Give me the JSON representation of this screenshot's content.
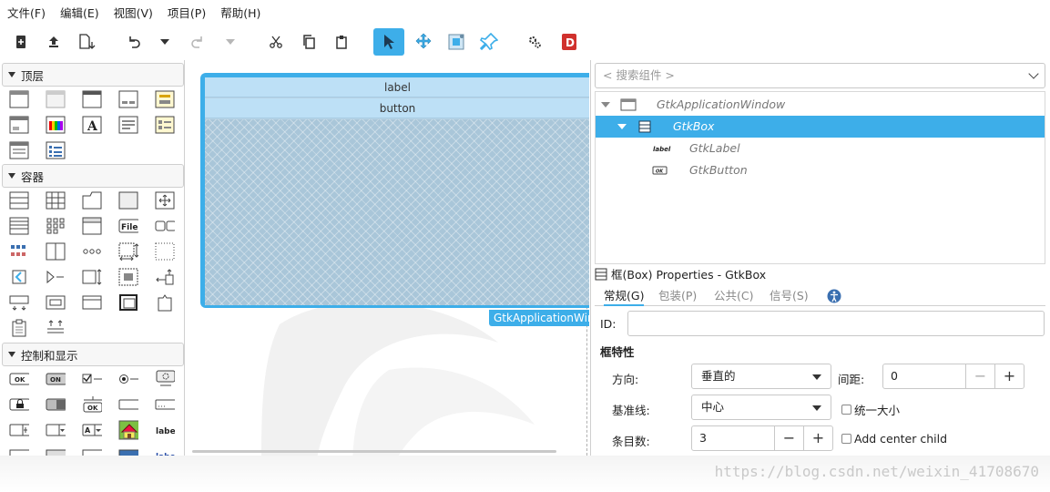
{
  "menubar": {
    "items": [
      "文件(F)",
      "编辑(E)",
      "视图(V)",
      "项目(P)",
      "帮助(H)"
    ]
  },
  "palette": {
    "categories": [
      "顶层",
      "容器",
      "控制和显示"
    ],
    "label_icon_text": "label",
    "ok_text": "OK",
    "on_text": "ON",
    "file_text": "File",
    "a_text": "A"
  },
  "canvas": {
    "row_label": "label",
    "row_button": "button",
    "window_tag": "GtkApplicationWindow"
  },
  "inspector": {
    "search_placeholder": "< 搜索组件 >",
    "tree": [
      {
        "name": "GtkApplicationWindow",
        "selected": false
      },
      {
        "name": "GtkBox",
        "selected": true
      },
      {
        "name": "GtkLabel",
        "selected": false
      },
      {
        "name": "GtkButton",
        "selected": false
      }
    ],
    "tree_label_icon": "label",
    "tree_ok_icon": "OK",
    "props_title": "框(Box) Properties - GtkBox",
    "tabs": [
      "常规(G)",
      "包装(P)",
      "公共(C)",
      "信号(S)"
    ],
    "id_label": "ID:",
    "id_value": "",
    "section_title": "框特性",
    "orientation_label": "方向:",
    "orientation_value": "垂直的",
    "spacing_label": "间距:",
    "spacing_value": "0",
    "baseline_label": "基准线:",
    "baseline_value": "中心",
    "homogeneous_label": "统一大小",
    "count_label": "条目数:",
    "count_value": "3",
    "center_child_label": "Add center child",
    "minus": "−",
    "plus": "+"
  },
  "watermark": "https://blog.csdn.net/weixin_41708670",
  "colors": {
    "accent": "#3daee9",
    "window_fill": "#bde0f6",
    "hatch": "#a9c6d9"
  }
}
